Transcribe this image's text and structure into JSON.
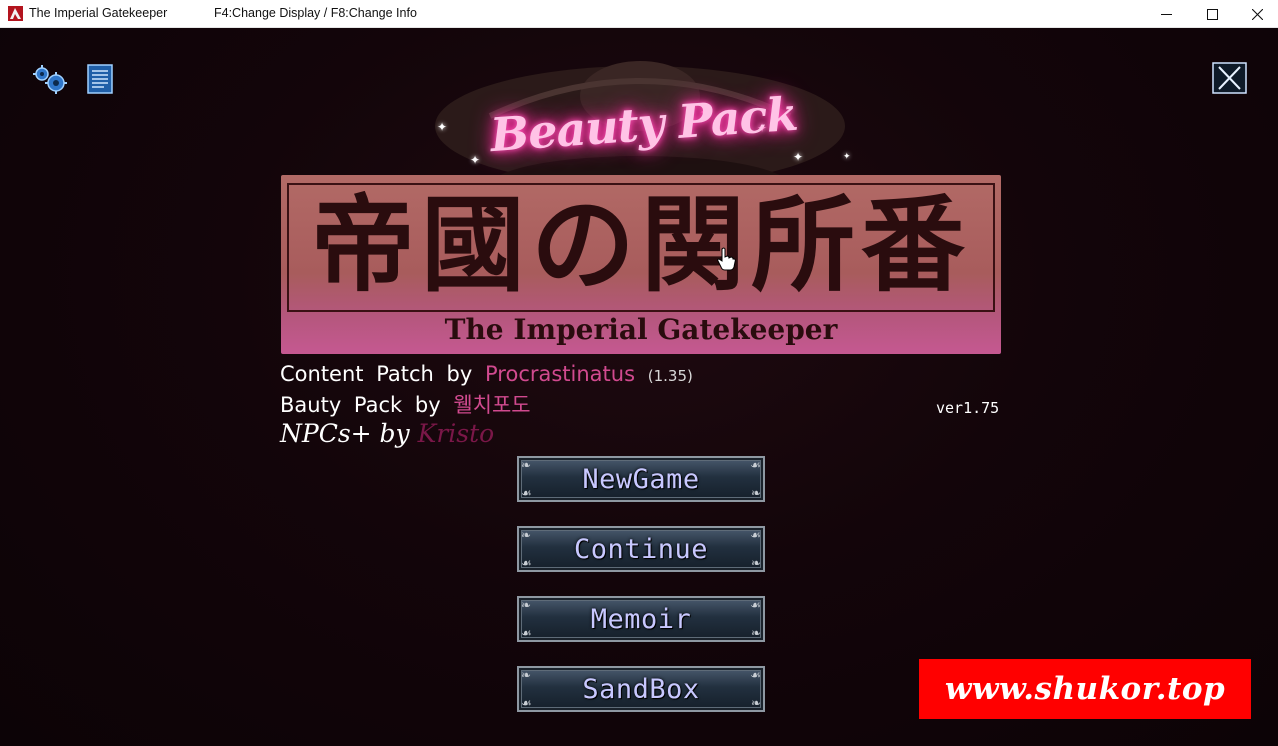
{
  "window": {
    "title": "The Imperial Gatekeeper",
    "hint": "F4:Change Display / F8:Change Info"
  },
  "logo": {
    "beauty_pack": "Beauty Pack",
    "kanji": "帝國の関所番",
    "subtitle": "The Imperial Gatekeeper"
  },
  "credits": {
    "line1_prefix": "Content Patch by",
    "line1_name": "Procrastinatus",
    "line1_version": "(1.35)",
    "line2_prefix": "Bauty Pack by",
    "line2_name": "웰치포도",
    "line3_prefix": "NPCs+ by",
    "line3_name": "Kristo"
  },
  "version": "ver1.75",
  "menu": {
    "items": [
      {
        "label": "NewGame"
      },
      {
        "label": "Continue"
      },
      {
        "label": "Memoir"
      },
      {
        "label": "SandBox"
      }
    ]
  },
  "watermark": "www.shukor.top",
  "colors": {
    "accent_pink": "#d14a8f",
    "menu_text": "#c8c8ff",
    "watermark_bg": "#ff0000"
  },
  "icons": {
    "app": "app-icon",
    "settings": "settings-gears-icon",
    "notes": "document-list-icon",
    "exit": "close-x-icon"
  }
}
